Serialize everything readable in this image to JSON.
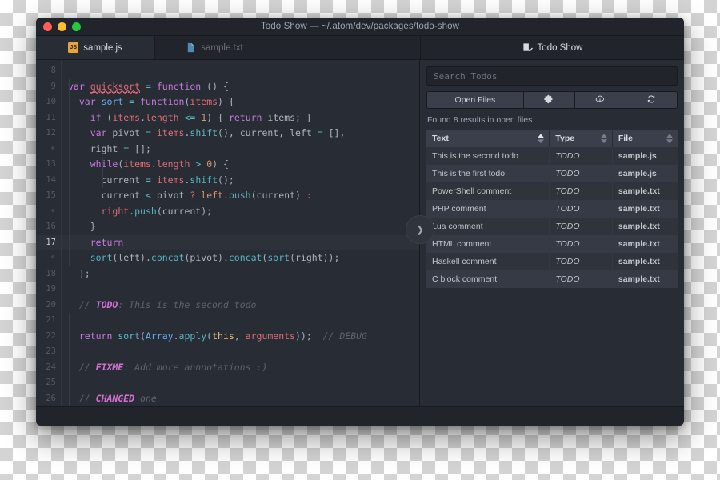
{
  "window": {
    "title": "Todo Show — ~/.atom/dev/packages/todo-show",
    "traffic": {
      "close": "close-button",
      "minimize": "minimize-button",
      "zoom": "zoom-button"
    }
  },
  "tabs": {
    "left": [
      {
        "label": "sample.js",
        "icon": "JS",
        "active": true
      },
      {
        "label": "sample.txt",
        "icon": "file-icon",
        "active": false
      }
    ],
    "right": {
      "label": "Todo Show",
      "icon": "todo-checklist-icon"
    }
  },
  "editor": {
    "gutter": [
      "8",
      "9",
      "10",
      "11",
      "12",
      "•",
      "13",
      "14",
      "15",
      "•",
      "16",
      "17",
      "•",
      "18",
      "19",
      "20",
      "21",
      "22",
      "23",
      "24",
      "25",
      "26"
    ],
    "current_line": "17",
    "breakpoint_line": "9",
    "lines": [
      "",
      "var quicksort = function () {",
      "  var sort = function(items) {",
      "    if (items.length <= 1) { return items; }",
      "    var pivot = items.shift(), current, left = [],",
      "    right = [];",
      "    while(items.length > 0) {",
      "      current = items.shift();",
      "      current < pivot ? left.push(current) :",
      "      right.push(current);",
      "    }",
      "    return",
      "    sort(left).concat(pivot).concat(sort(right));",
      "  };",
      "",
      "  // TODO: This is the second todo",
      "",
      "  return sort(Array.apply(this, arguments));  // DEBUG",
      "",
      "  // FIXME: Add more annnotations :)",
      "",
      "  // CHANGED one"
    ]
  },
  "todo_panel": {
    "search": {
      "placeholder": "Search Todos",
      "value": ""
    },
    "buttons": {
      "open_files": "Open Files",
      "settings": "gear-icon",
      "save": "cloud-download-icon",
      "refresh": "refresh-icon"
    },
    "results_count": "Found 8 results in open files",
    "table": {
      "columns": [
        {
          "label": "Text",
          "sort": "asc"
        },
        {
          "label": "Type",
          "sort": "none"
        },
        {
          "label": "File",
          "sort": "none"
        }
      ],
      "rows": [
        {
          "text": "This is the second todo",
          "type": "TODO",
          "file": "sample.js"
        },
        {
          "text": "This is the first todo",
          "type": "TODO",
          "file": "sample.js"
        },
        {
          "text": "PowerShell comment",
          "type": "TODO",
          "file": "sample.txt"
        },
        {
          "text": "PHP comment",
          "type": "TODO",
          "file": "sample.txt"
        },
        {
          "text": "Lua comment",
          "type": "TODO",
          "file": "sample.txt"
        },
        {
          "text": "HTML comment",
          "type": "TODO",
          "file": "sample.txt"
        },
        {
          "text": "Haskell comment",
          "type": "TODO",
          "file": "sample.txt"
        },
        {
          "text": "C block comment",
          "type": "TODO",
          "file": "sample.txt"
        }
      ]
    }
  },
  "resize_handle": {
    "icon": "chevron-right-icon"
  },
  "colors": {
    "background": "#282c34",
    "chrome": "#21252b",
    "accent_keyword": "#c678dd",
    "accent_function": "#61afef",
    "accent_variable": "#e06c75",
    "accent_operator": "#56b6c2",
    "accent_number": "#d19a66",
    "accent_comment": "#5c6370",
    "accent_todo": "#d670d6",
    "traffic_red": "#ff5f56",
    "traffic_yellow": "#ffbd2e",
    "traffic_green": "#27c93f"
  }
}
